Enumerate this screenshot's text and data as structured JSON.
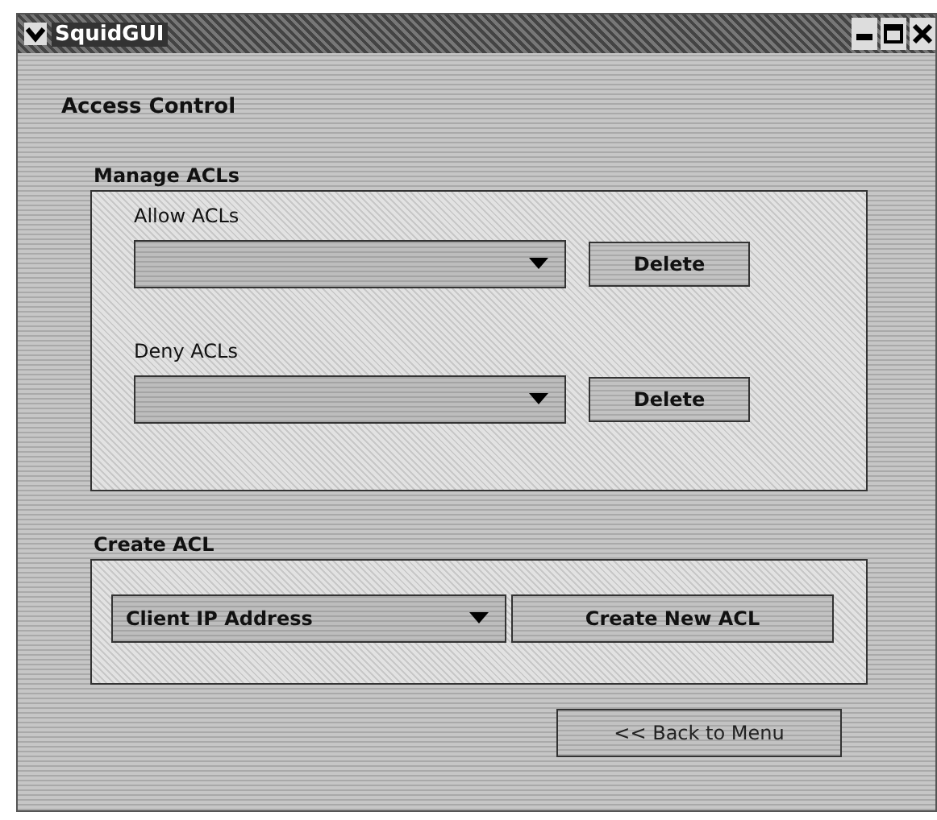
{
  "window": {
    "title": "SquidGUI"
  },
  "heading": "Access Control",
  "manage": {
    "title": "Manage ACLs",
    "lists": [
      {
        "label": "Allow ACLs",
        "button": "Delete"
      },
      {
        "label": "Deny ACLs",
        "button": "Delete"
      }
    ]
  },
  "create": {
    "title": "Create ACL",
    "type_value": "Client IP Address",
    "button": "Create New ACL"
  },
  "back_button": "<< Back to Menu"
}
